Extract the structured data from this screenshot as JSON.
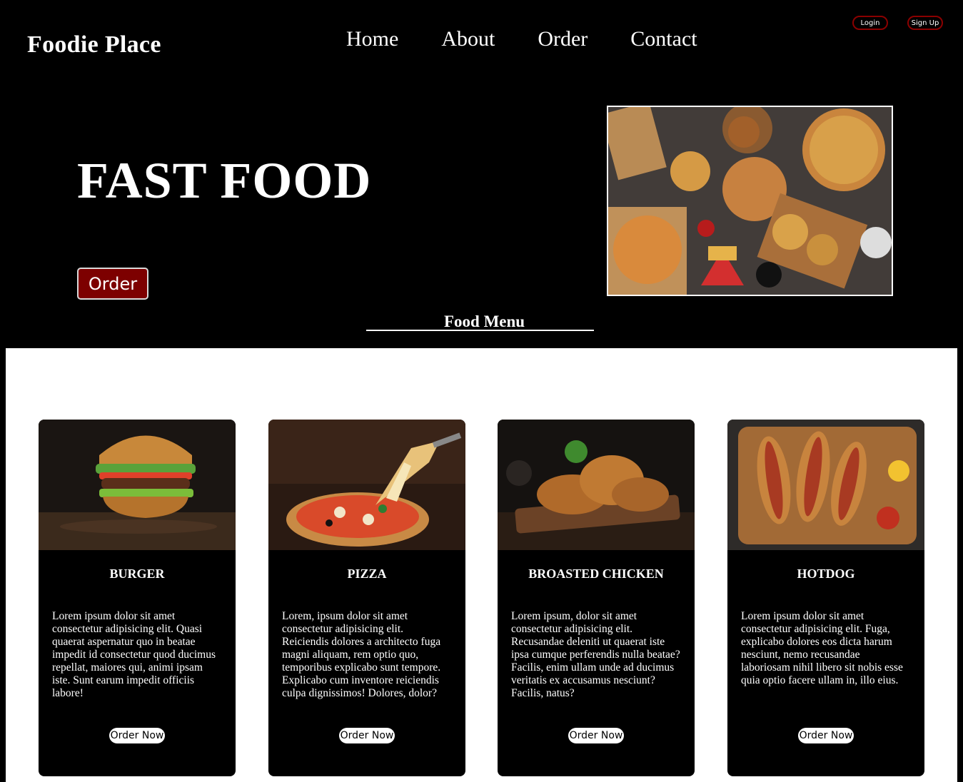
{
  "brand": "Foodie Place",
  "nav": [
    "Home",
    "About",
    "Order",
    "Contact"
  ],
  "auth": {
    "login": "Login",
    "signup": "Sign Up"
  },
  "hero": {
    "title": "FAST FOOD",
    "order_label": "Order"
  },
  "menu_heading": "Food Menu",
  "cards": [
    {
      "title": "BURGER",
      "text": "Lorem ipsum dolor sit amet consectetur adipisicing elit. Quasi quaerat aspernatur quo in beatae impedit id consectetur quod ducimus repellat, maiores qui, animi ipsam iste. Sunt earum impedit officiis labore!",
      "button": "Order Now"
    },
    {
      "title": "PIZZA",
      "text": "Lorem, ipsum dolor sit amet consectetur adipisicing elit. Reiciendis dolores a architecto fuga magni aliquam, rem optio quo, temporibus explicabo sunt tempore. Explicabo cum inventore reiciendis culpa dignissimos! Dolores, dolor?",
      "button": "Order Now"
    },
    {
      "title": "BROASTED CHICKEN",
      "text": "Lorem ipsum, dolor sit amet consectetur adipisicing elit. Recusandae deleniti ut quaerat iste ipsa cumque perferendis nulla beatae? Facilis, enim ullam unde ad ducimus veritatis ex accusamus nesciunt? Facilis, natus?",
      "button": "Order Now"
    },
    {
      "title": "HOTDOG",
      "text": "Lorem ipsum dolor sit amet consectetur adipisicing elit. Fuga, explicabo dolores eos dicta harum nesciunt, nemo recusandae laboriosam nihil libero sit nobis esse quia optio facere ullam in, illo eius.",
      "button": "Order Now"
    }
  ],
  "colors": {
    "background": "#000000",
    "accent": "#7d0000",
    "menu_bg": "#ffffff"
  }
}
